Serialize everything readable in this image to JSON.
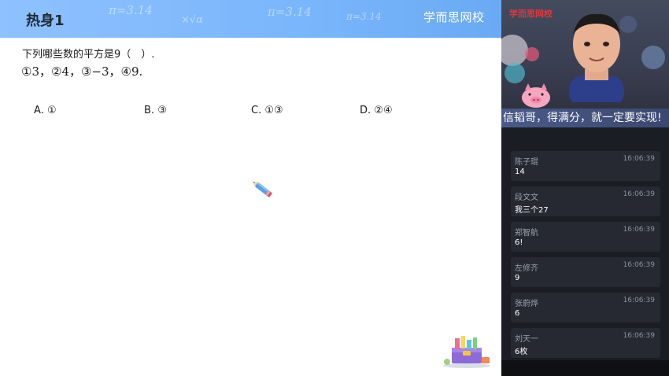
{
  "lesson": {
    "section_title": "热身1",
    "brand": "学而思网校",
    "question": "下列哪些数的平方是9（　）.",
    "items": "①3，②4，③−3，④9.",
    "choices": [
      {
        "label": "A.",
        "value": "①"
      },
      {
        "label": "B.",
        "value": "③"
      },
      {
        "label": "C.",
        "value": "①③"
      },
      {
        "label": "D.",
        "value": "②④"
      }
    ],
    "doodles": [
      "π=3.14",
      "π=3.14",
      "×√α",
      "π=3.14"
    ]
  },
  "video": {
    "logo": "学而思网校",
    "logo_tail": "网校",
    "slogan": "信韬哥，得满分，就一定要实现!"
  },
  "chat": {
    "messages": [
      {
        "user": "陈子琨",
        "time": "16:06:39",
        "text": "14"
      },
      {
        "user": "段文文",
        "time": "16:06:39",
        "text": "我三个27"
      },
      {
        "user": "郑智航",
        "time": "16:06:39",
        "text": "6!"
      },
      {
        "user": "左修齐",
        "time": "16:06:39",
        "text": "9"
      },
      {
        "user": "张蔚烨",
        "time": "16:06:39",
        "text": "6"
      },
      {
        "user": "刘天一",
        "time": "16:06:39",
        "text": "6枚"
      }
    ]
  },
  "colors": {
    "header_blue": "#7ab6fb",
    "chat_bg": "#1b1d24",
    "card_bg": "#262932",
    "slogan_bg": "#4a5a88",
    "logo_red": "#e0383c"
  }
}
